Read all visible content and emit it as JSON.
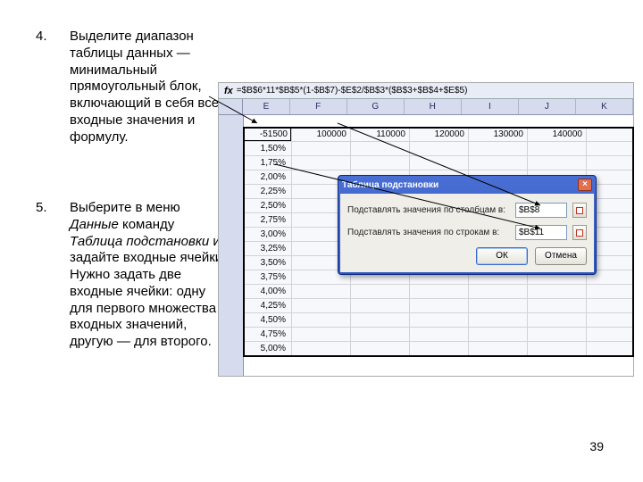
{
  "instructions": {
    "n4": "4.",
    "t4a": "Выделите диапазон",
    "t4b": "таблицы данных —",
    "t4c": "минимальный",
    "t4d": "прямоугольный блок,",
    "t4e": "включающий в себя все",
    "t4f": "входные значения и",
    "t4g": "формулу.",
    "n5": "5.",
    "t5a": "Выберите в меню",
    "t5b": "Данные",
    "t5c": " команду",
    "t5d": "Таблица подстановки",
    "t5e": " и",
    "t5f": "задайте входные ячейки.",
    "t5g": "Нужно задать две",
    "t5h": "входные ячейки: одну",
    "t5i": "для первого множества",
    "t5j": "входных значений,",
    "t5k": "другую — для второго."
  },
  "pagenum": "39",
  "excel": {
    "fxlabel": "fx",
    "formula": "=$B$6*11*$B$5*(1-$B$7)-$E$2/$B$3*($B$3+$B$4+$E$5)",
    "cols": [
      "E",
      "F",
      "G",
      "H",
      "I",
      "J",
      "K"
    ],
    "row0": [
      "-51500",
      "100000",
      "110000",
      "120000",
      "130000",
      "140000"
    ],
    "percents": [
      "1,50%",
      "1,75%",
      "2,00%",
      "2,25%",
      "2,50%",
      "2,75%",
      "3,00%",
      "3,25%",
      "3,50%",
      "3,75%",
      "4,00%",
      "4,25%",
      "4,50%",
      "4,75%",
      "5,00%"
    ]
  },
  "dialog": {
    "title": "Таблица подстановки",
    "lbl1": "Подставлять значения по столбцам в:",
    "lbl2": "Подставлять значения по строкам в:",
    "v1": "$B$8",
    "v2": "$B$11",
    "ok": "ОК",
    "cancel": "Отмена"
  }
}
